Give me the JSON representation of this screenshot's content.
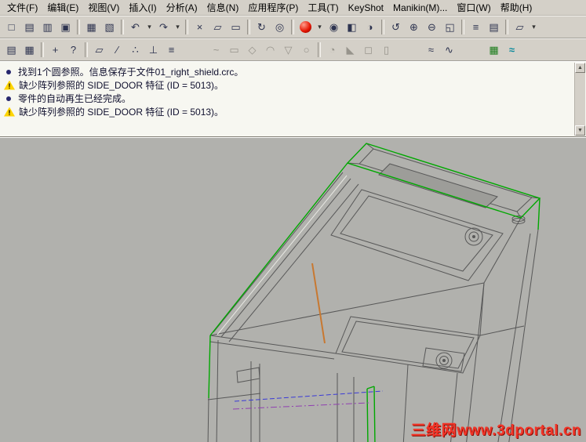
{
  "menu": {
    "items": [
      {
        "name": "menu-file",
        "label": "文件(F)"
      },
      {
        "name": "menu-edit",
        "label": "编辑(E)"
      },
      {
        "name": "menu-view",
        "label": "视图(V)"
      },
      {
        "name": "menu-insert",
        "label": "插入(I)"
      },
      {
        "name": "menu-analysis",
        "label": "分析(A)"
      },
      {
        "name": "menu-info",
        "label": "信息(N)"
      },
      {
        "name": "menu-applications",
        "label": "应用程序(P)"
      },
      {
        "name": "menu-tools",
        "label": "工具(T)"
      },
      {
        "name": "menu-keyshot",
        "label": "KeyShot"
      },
      {
        "name": "menu-manikin",
        "label": "Manikin(M)..."
      },
      {
        "name": "menu-window",
        "label": "窗口(W)"
      },
      {
        "name": "menu-help",
        "label": "帮助(H)"
      }
    ]
  },
  "toolbar1": {
    "icons": [
      {
        "name": "new-file-icon",
        "glyph": "□"
      },
      {
        "name": "open-file-icon",
        "glyph": "▤"
      },
      {
        "name": "open-session-icon",
        "glyph": "▥"
      },
      {
        "name": "save-icon",
        "glyph": "▣"
      },
      {
        "sep": true
      },
      {
        "name": "print-icon",
        "glyph": "▦"
      },
      {
        "name": "print-preview-icon",
        "glyph": "▧"
      },
      {
        "sep": true
      },
      {
        "name": "undo-icon",
        "glyph": "↶"
      },
      {
        "name": "undo-dropdown-icon",
        "glyph": "▾",
        "cls": "dd"
      },
      {
        "name": "redo-icon",
        "glyph": "↷"
      },
      {
        "name": "redo-dropdown-icon",
        "glyph": "▾",
        "cls": "dd"
      },
      {
        "sep": true
      },
      {
        "name": "cut-icon",
        "glyph": "×"
      },
      {
        "name": "copy-icon",
        "glyph": "▱"
      },
      {
        "name": "paste-icon",
        "glyph": "▭"
      },
      {
        "sep": true
      },
      {
        "name": "regenerate-icon",
        "glyph": "↻"
      },
      {
        "name": "find-icon",
        "glyph": "◎"
      },
      {
        "sep": true
      },
      {
        "name": "appearance-sphere-icon",
        "glyph": "",
        "cls": "sphere"
      },
      {
        "name": "appearance-dropdown-icon",
        "glyph": "▾",
        "cls": "dd"
      },
      {
        "name": "view-eye-icon",
        "glyph": "◉"
      },
      {
        "name": "hidden-line-icon",
        "glyph": "◧"
      },
      {
        "name": "shading-icon",
        "glyph": "◑"
      },
      {
        "sep": true
      },
      {
        "name": "redraw-icon",
        "glyph": "↺"
      },
      {
        "name": "zoom-in-icon",
        "glyph": "⊕"
      },
      {
        "name": "zoom-out-icon",
        "glyph": "⊖"
      },
      {
        "name": "refit-icon",
        "glyph": "◱"
      },
      {
        "sep": true
      },
      {
        "name": "layers-icon",
        "glyph": "≡"
      },
      {
        "name": "view-manager-icon",
        "glyph": "▤"
      },
      {
        "sep": true
      },
      {
        "name": "annotate-icon",
        "glyph": "▱"
      },
      {
        "name": "saved-views-dropdown-icon",
        "glyph": "▾",
        "cls": "dd"
      }
    ]
  },
  "toolbar2": {
    "icons": [
      {
        "name": "search-book-icon",
        "glyph": "▤"
      },
      {
        "name": "model-grid-icon",
        "glyph": "▦"
      },
      {
        "sep": true
      },
      {
        "name": "pan-hand-icon",
        "glyph": "+"
      },
      {
        "name": "context-help-icon",
        "glyph": "?"
      },
      {
        "sep": true
      },
      {
        "name": "datum-plane-icon",
        "glyph": "▱"
      },
      {
        "name": "datum-axis-icon",
        "glyph": "∕"
      },
      {
        "name": "datum-point-icon",
        "glyph": "∴"
      },
      {
        "name": "datum-csys-icon",
        "glyph": "⊥"
      },
      {
        "name": "layer-stack-icon",
        "glyph": "≡"
      },
      {
        "gap": true
      },
      {
        "name": "sketch-tool-icon",
        "glyph": "~",
        "cls": "dis"
      },
      {
        "name": "extrude-tool-icon",
        "glyph": "▭",
        "cls": "dis"
      },
      {
        "name": "revolve-tool-icon",
        "glyph": "◇",
        "cls": "dis"
      },
      {
        "name": "sweep-tool-icon",
        "glyph": "◠",
        "cls": "dis"
      },
      {
        "name": "blend-tool-icon",
        "glyph": "▽",
        "cls": "dis"
      },
      {
        "name": "hole-tool-icon",
        "glyph": "○",
        "cls": "dis"
      },
      {
        "sep": true
      },
      {
        "name": "round-tool-icon",
        "glyph": "◔",
        "cls": "dis"
      },
      {
        "name": "chamfer-tool-icon",
        "glyph": "◣",
        "cls": "dis"
      },
      {
        "name": "shell-tool-icon",
        "glyph": "◻",
        "cls": "dis"
      },
      {
        "name": "rib-tool-icon",
        "glyph": "▯",
        "cls": "dis"
      },
      {
        "gap": true
      },
      {
        "name": "style-surface-icon",
        "glyph": "≈"
      },
      {
        "name": "warp-tool-icon",
        "glyph": "∿"
      },
      {
        "gap": true
      },
      {
        "name": "sheet-table-icon",
        "glyph": "▦",
        "cls": "c-green"
      },
      {
        "name": "surface-waves-icon",
        "glyph": "≈",
        "cls": "c-teal"
      }
    ]
  },
  "messages": {
    "lines": [
      {
        "icon": "dot",
        "text": "找到1个圆参照。信息保存于文件01_right_shield.crc。"
      },
      {
        "icon": "warning",
        "text": "缺少阵列参照的 SIDE_DOOR 特征 (ID = 5013)。"
      },
      {
        "icon": "dot",
        "text": "零件的自动再生已经完成。"
      },
      {
        "icon": "warning",
        "text": "缺少阵列参照的 SIDE_DOOR 特征 (ID = 5013)。"
      }
    ],
    "scroll_up_glyph": "▲",
    "scroll_down_glyph": "▼"
  },
  "viewport": {
    "watermark": "三维网www.3dportal.cn",
    "colors": {
      "background": "#b1b1ad",
      "wireframe_gray": "#585858",
      "wireframe_green": "#00a800",
      "wireframe_orange": "#c87830",
      "centerline_blue": "#3a3ad6",
      "centerline_purple": "#9040b0",
      "watermark_red": "#f23528",
      "warning_yellow": "#ffd400"
    }
  }
}
